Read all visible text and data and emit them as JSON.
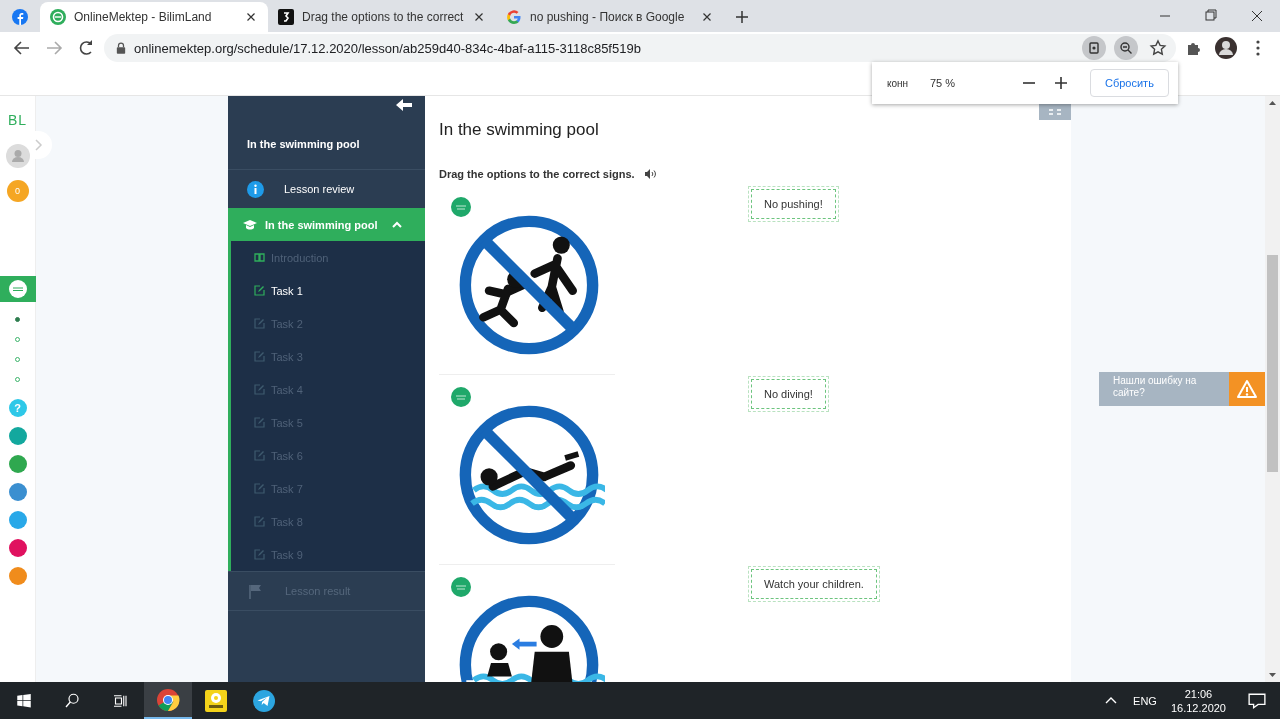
{
  "browser": {
    "tabs": [
      {
        "kind": "facebook",
        "selected": false
      },
      {
        "kind": "bilimland",
        "title": "OnlineMektep - BilimLand",
        "selected": true
      },
      {
        "kind": "task",
        "title": "Drag the options to the correct",
        "selected": false
      },
      {
        "kind": "google",
        "title": "no pushing - Поиск в Google",
        "selected": false
      }
    ],
    "url": "onlinemektep.org/schedule/17.12.2020/lesson/ab259d40-834c-4baf-a115-3118c85f519b",
    "zoom_popup": {
      "cut_text": "конн",
      "value": "75 %",
      "reset": "Сбросить"
    }
  },
  "rail": {
    "logo": "BL",
    "badge": "0",
    "dots": [
      {
        "selected": true
      },
      {
        "selected": false
      },
      {
        "selected": false
      },
      {
        "selected": false
      }
    ],
    "apps": [
      {
        "color": "#2ec8e8",
        "label": "?"
      },
      {
        "color": "#13a89e"
      },
      {
        "color": "#2fa84f"
      },
      {
        "color": "#3b8fd0"
      },
      {
        "color": "#29a8e8"
      },
      {
        "color": "#e0115f"
      },
      {
        "color": "#f08c1c"
      }
    ]
  },
  "sidebar": {
    "title": "In the swimming pool",
    "review": "Lesson review",
    "section": {
      "label": "In the swimming pool",
      "expanded": true,
      "children": [
        {
          "kind": "intro",
          "label": "Introduction",
          "selected": false
        },
        {
          "kind": "task",
          "label": "Task 1",
          "selected": true
        },
        {
          "kind": "task",
          "label": "Task 2",
          "selected": false
        },
        {
          "kind": "task",
          "label": "Task 3",
          "selected": false
        },
        {
          "kind": "task",
          "label": "Task 4",
          "selected": false
        },
        {
          "kind": "task",
          "label": "Task 5",
          "selected": false
        },
        {
          "kind": "task",
          "label": "Task 6",
          "selected": false
        },
        {
          "kind": "task",
          "label": "Task 7",
          "selected": false
        },
        {
          "kind": "task",
          "label": "Task 8",
          "selected": false
        },
        {
          "kind": "task",
          "label": "Task 9",
          "selected": false
        }
      ]
    },
    "result": "Lesson result"
  },
  "main": {
    "title": "In the swimming pool",
    "instruction": "Drag the options to the correct signs.",
    "questions": [
      {
        "kind": "no-pushing",
        "answer": "No pushing!"
      },
      {
        "kind": "no-diving",
        "answer": "No diving!"
      },
      {
        "kind": "watch-children",
        "answer": "Watch your children."
      }
    ]
  },
  "feedback": "Нашли ошибку на сайте?",
  "taskbar": {
    "apps": [
      {
        "kind": "chrome",
        "selected": true
      },
      {
        "kind": "player",
        "selected": false
      },
      {
        "kind": "telegram",
        "selected": false
      }
    ],
    "lang": "ENG",
    "time": "21:06",
    "date": "16.12.2020"
  }
}
